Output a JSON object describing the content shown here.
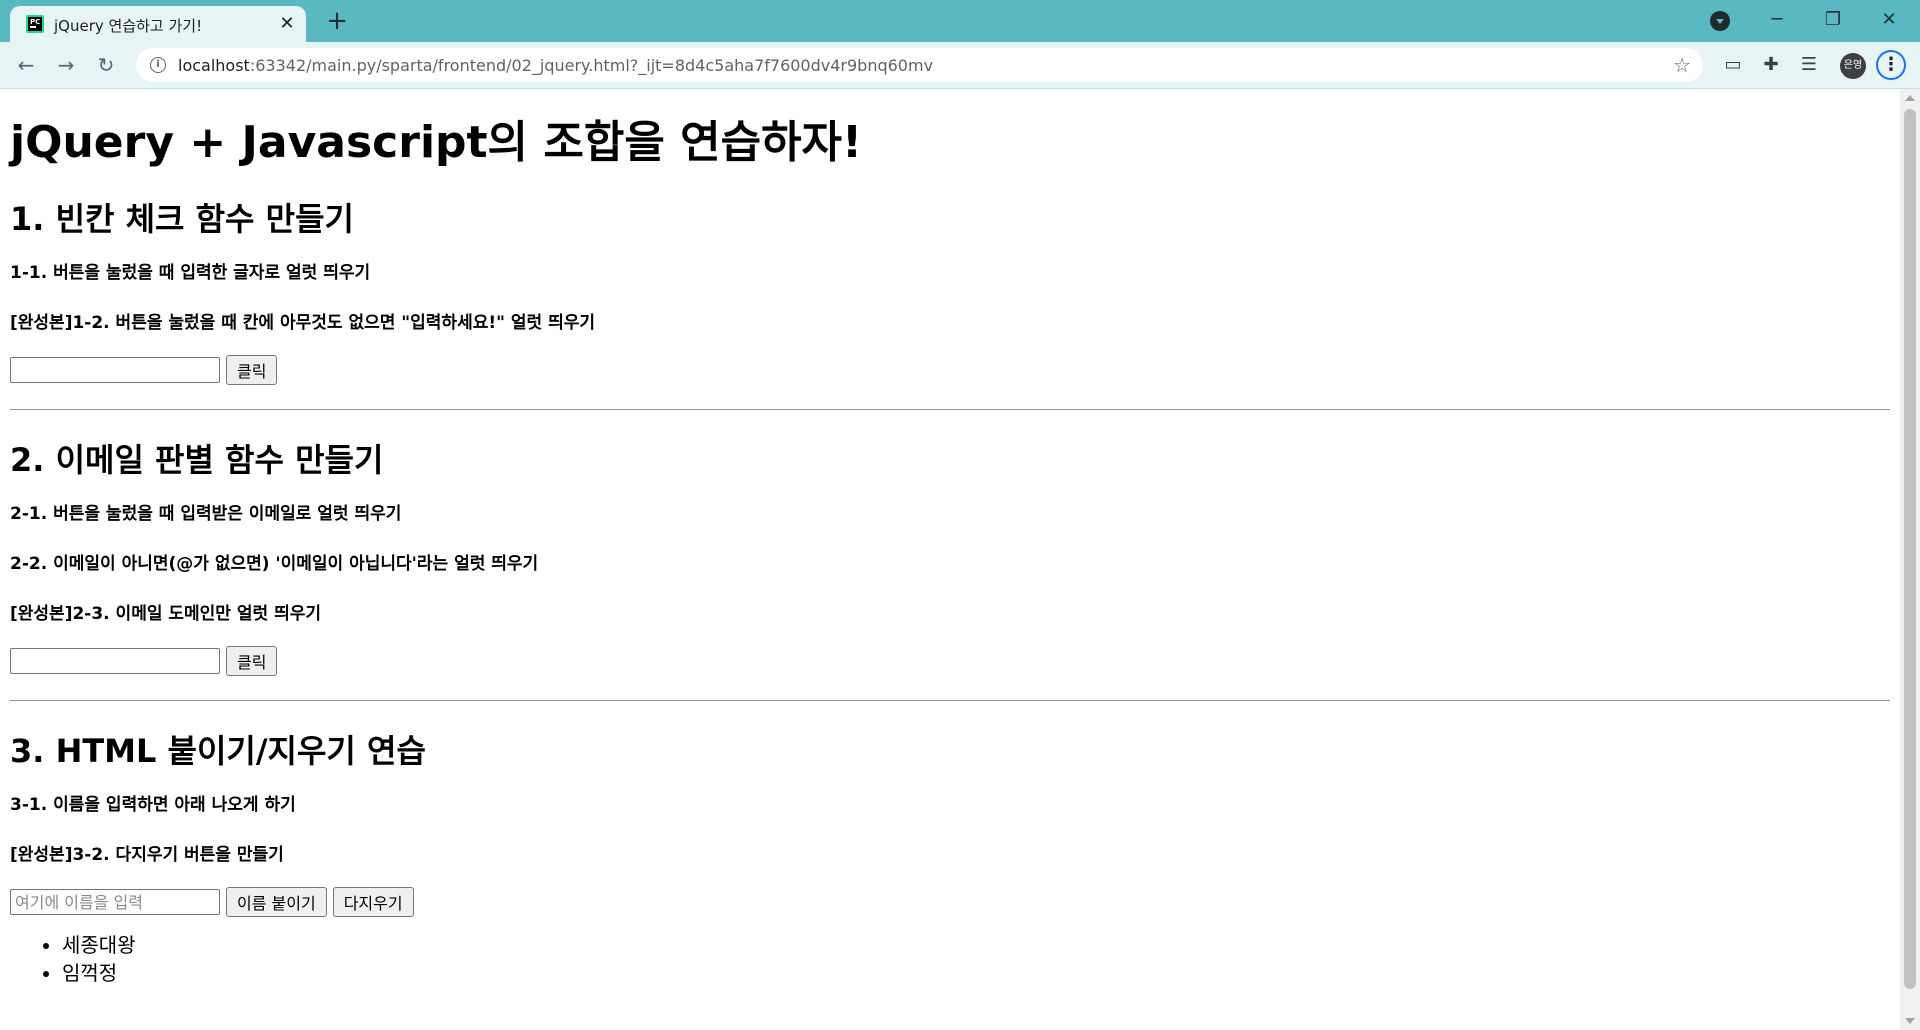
{
  "browser": {
    "tab_title": "jQuery 연습하고 가기!",
    "tab_close": "✕",
    "new_tab": "+",
    "url_host": "localhost",
    "url_rest": ":63342/main.py/sparta/frontend/02_jquery.html?_ijt=8d4c5aha7f7600dv4r9bnq60mv",
    "profile_label": "은영",
    "icons": {
      "back": "back-arrow-icon",
      "forward": "forward-arrow-icon",
      "reload": "reload-icon",
      "info": "info-icon",
      "bookmark": "star-icon",
      "cast": "cast-icon",
      "extensions": "puzzle-icon",
      "reading_list": "reading-list-icon",
      "menu": "kebab-menu-icon"
    },
    "window_controls": {
      "minimize": "─",
      "restore": "❐",
      "close": "✕"
    }
  },
  "page": {
    "title": "jQuery + Javascript의 조합을 연습하자!",
    "section1": {
      "heading": "1. 빈칸 체크 함수 만들기",
      "tasks": [
        "1-1. 버튼을 눌렀을 때 입력한 글자로 얼럿 띄우기",
        "[완성본]1-2. 버튼을 눌렀을 때 칸에 아무것도 없으면 \"입력하세요!\" 얼럿 띄우기"
      ],
      "input_value": "",
      "button_label": "클릭"
    },
    "section2": {
      "heading": "2. 이메일 판별 함수 만들기",
      "tasks": [
        "2-1. 버튼을 눌렀을 때 입력받은 이메일로 얼럿 띄우기",
        "2-2. 이메일이 아니면(@가 없으면) '이메일이 아닙니다'라는 얼럿 띄우기",
        "[완성본]2-3. 이메일 도메인만 얼럿 띄우기"
      ],
      "input_value": "",
      "button_label": "클릭"
    },
    "section3": {
      "heading": "3. HTML 붙이기/지우기 연습",
      "tasks": [
        "3-1. 이름을 입력하면 아래 나오게 하기",
        "[완성본]3-2. 다지우기 버튼을 만들기"
      ],
      "input_placeholder": "여기에 이름을 입력",
      "append_button_label": "이름 붙이기",
      "clear_button_label": "다지우기",
      "names": [
        "세종대왕",
        "임꺽정"
      ]
    }
  }
}
